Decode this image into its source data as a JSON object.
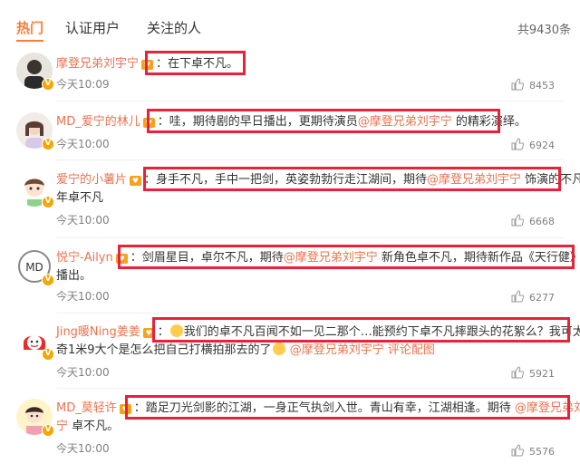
{
  "tabs": [
    {
      "label": "热门",
      "active": true
    },
    {
      "label": "认证用户",
      "active": false
    },
    {
      "label": "关注的人",
      "active": false
    }
  ],
  "total_label": "共9430条",
  "accent_color": "#fa7d3c",
  "highlight_color": "#e8223a",
  "comments": [
    {
      "user": "摩登兄弟刘宇宁",
      "text": "：在下卓不凡。",
      "time": "今天10:09",
      "likes": "8453"
    },
    {
      "user": "MD_爱宁的林儿",
      "text_a": "：哇，期待剧的早日播出，更期待演员",
      "mention": "@摩登兄弟刘宇宁",
      "text_b": " 的精彩演绎。",
      "time": "今天10:00",
      "likes": "6924"
    },
    {
      "user": "爱宁的小薯片",
      "text_a": "：身手不凡，手中一把剑，英姿勃勃行走江湖间，期待",
      "mention": "@摩登兄弟刘宇宁",
      "text_b": " 饰演的不凡少",
      "text_c": "年卓不凡",
      "time": "今天10:00",
      "likes": "6668"
    },
    {
      "user": "悦宁-Ailyn",
      "text_a": "：剑眉星目，卓尔不凡，期待",
      "mention": "@摩登兄弟刘宇宁",
      "text_b": " 新角色卓不凡，期待新作品《天行健》早日",
      "text_c": "播出。",
      "time": "今天10:00",
      "likes": "6277"
    },
    {
      "user": "Jing暖Ning姜姜",
      "text_a": "：",
      "text_b": "我们的卓不凡百闻不如一见二那个…能预约下卓不凡摔跟头的花絮么？我可太好",
      "text_c": "奇1米9大个是怎么把自己打横拍那去的了",
      "mention": "@摩登兄弟刘宇宁",
      "extra": "评论配图",
      "time": "今天10:00",
      "likes": "5921"
    },
    {
      "user": "MD_莫轻许",
      "text_a": "：踏足刀光剑影的江湖，一身正气执剑入世。青山有幸，江湖相逢。期待",
      "mention_a": "@摩登兄弟刘宇",
      "mention_b": "宁",
      "text_b": " 卓不凡。",
      "time": "今天10:00",
      "likes": "5576"
    }
  ]
}
